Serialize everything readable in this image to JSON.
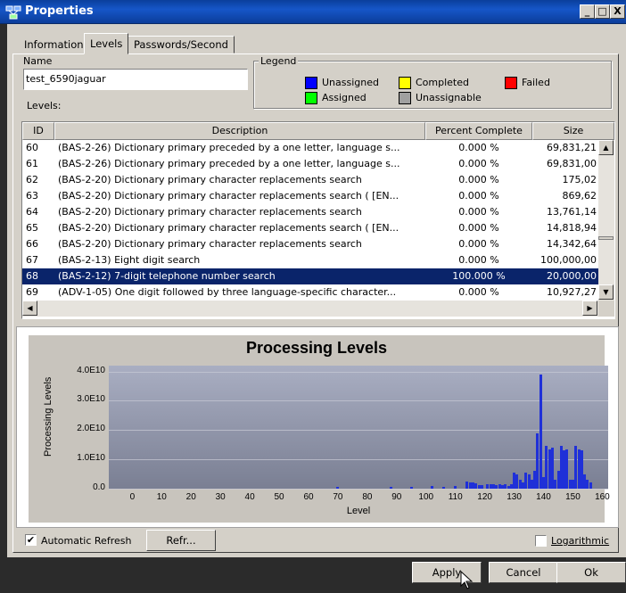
{
  "window": {
    "title": "Properties",
    "minimize": "_",
    "maximize": "□",
    "close": "X"
  },
  "tabs": [
    {
      "label": "Information"
    },
    {
      "label": "Levels"
    },
    {
      "label": "Passwords/Second"
    }
  ],
  "name_field": {
    "label": "Name",
    "value": "test_6590jaguar"
  },
  "levels_label": "Levels:",
  "legend": {
    "title": "Legend",
    "items": [
      {
        "label": "Unassigned",
        "color": "#0000ff"
      },
      {
        "label": "Completed",
        "color": "#ffff00"
      },
      {
        "label": "Failed",
        "color": "#ff0000"
      },
      {
        "label": "Assigned",
        "color": "#00ff00"
      },
      {
        "label": "Unassignable",
        "color": "#a0a0a0"
      }
    ]
  },
  "table": {
    "columns": [
      "ID",
      "Description",
      "Percent Complete",
      "Size"
    ],
    "rows": [
      {
        "id": "60",
        "desc": "(BAS-2-26) Dictionary primary preceded by a one letter, language s...",
        "pct": "0.000 %",
        "size": "69,831,21"
      },
      {
        "id": "61",
        "desc": "(BAS-2-26) Dictionary primary preceded by a one letter, language s...",
        "pct": "0.000 %",
        "size": "69,831,00"
      },
      {
        "id": "62",
        "desc": "(BAS-2-20) Dictionary primary character replacements search",
        "pct": "0.000 %",
        "size": "175,02"
      },
      {
        "id": "63",
        "desc": "(BAS-2-20) Dictionary primary character replacements search ( [EN...",
        "pct": "0.000 %",
        "size": "869,62"
      },
      {
        "id": "64",
        "desc": "(BAS-2-20) Dictionary primary character replacements search",
        "pct": "0.000 %",
        "size": "13,761,14"
      },
      {
        "id": "65",
        "desc": "(BAS-2-20) Dictionary primary character replacements search ( [EN...",
        "pct": "0.000 %",
        "size": "14,818,94"
      },
      {
        "id": "66",
        "desc": "(BAS-2-20) Dictionary primary character replacements search",
        "pct": "0.000 %",
        "size": "14,342,64"
      },
      {
        "id": "67",
        "desc": "(BAS-2-13) Eight digit search",
        "pct": "0.000 %",
        "size": "100,000,00"
      },
      {
        "id": "68",
        "desc": "(BAS-2-12) 7-digit telephone number search",
        "pct": "100.000 %",
        "size": "20,000,00",
        "selected": true
      },
      {
        "id": "69",
        "desc": "(ADV-1-05) One digit followed by three language-specific character...",
        "pct": "0.000 %",
        "size": "10,927,27"
      }
    ]
  },
  "chart_data": {
    "type": "bar",
    "title": "Processing Levels",
    "xlabel": "Level",
    "ylabel": "Processing Levels",
    "xlim": [
      -8,
      162
    ],
    "ylim": [
      0,
      42000000000.0
    ],
    "yticks": [
      "4.0E10",
      "3.0E10",
      "2.0E10",
      "1.0E10",
      "0.0"
    ],
    "xticks": [
      "0",
      "10",
      "20",
      "30",
      "40",
      "50",
      "60",
      "70",
      "80",
      "90",
      "100",
      "110",
      "120",
      "130",
      "140",
      "150",
      "160"
    ],
    "grid": true,
    "color": "#1f30d8",
    "x": [
      70,
      88,
      95,
      102,
      106,
      110,
      114,
      115,
      116,
      117,
      118,
      119,
      121,
      122,
      123,
      124,
      125,
      126,
      127,
      128,
      129,
      130,
      131,
      132,
      133,
      134,
      135,
      136,
      137,
      138,
      139,
      140,
      141,
      142,
      143,
      144,
      145,
      146,
      147,
      148,
      149,
      150,
      151,
      152,
      153,
      154,
      155,
      156
    ],
    "values": [
      500000000.0,
      500000000.0,
      500000000.0,
      800000000.0,
      600000000.0,
      1000000000.0,
      2500000000.0,
      2200000000.0,
      2200000000.0,
      1800000000.0,
      1200000000.0,
      1200000000.0,
      1500000000.0,
      1400000000.0,
      1500000000.0,
      1300000000.0,
      1400000000.0,
      1200000000.0,
      1500000000.0,
      1000000000.0,
      1500000000.0,
      5500000000.0,
      5000000000.0,
      3000000000.0,
      2000000000.0,
      5500000000.0,
      5000000000.0,
      3000000000.0,
      6000000000.0,
      19000000000.0,
      39000000000.0,
      4000000000.0,
      14500000000.0,
      13500000000.0,
      14000000000.0,
      3000000000.0,
      6000000000.0,
      14500000000.0,
      13000000000.0,
      13500000000.0,
      3000000000.0,
      3000000000.0,
      14500000000.0,
      13500000000.0,
      13000000000.0,
      5000000000.0,
      3000000000.0,
      2000000000.0
    ]
  },
  "controls": {
    "auto_refresh_label": "Automatic Refresh",
    "auto_refresh_checked": "✔",
    "refresh_button": "Refr...",
    "logarithmic_label": "Logarithmic",
    "apply": "Apply",
    "cancel": "Cancel",
    "ok": "Ok"
  }
}
